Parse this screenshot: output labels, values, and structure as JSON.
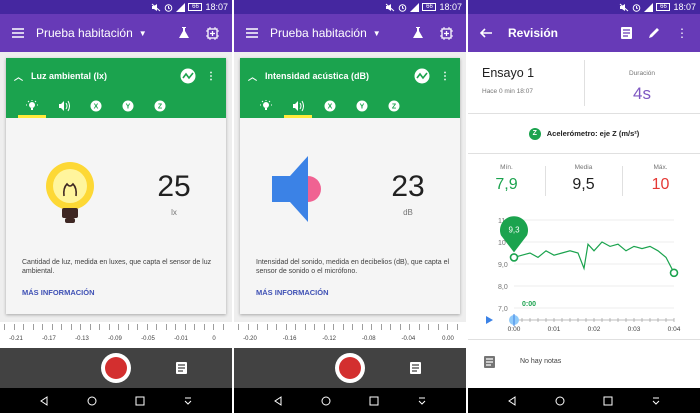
{
  "status": {
    "time": "18:07",
    "battery": "66"
  },
  "phone1": {
    "app_title": "Prueba habitación",
    "card_title": "Luz ambiental (lx)",
    "value": "25",
    "unit": "lx",
    "description": "Cantidad de luz, medida en luxes, que capta el sensor de luz ambiental.",
    "more_info": "MÁS INFORMACIÓN",
    "ruler_ticks": [
      "-0.21",
      "-0.17",
      "-0.13",
      "-0.09",
      "-0.05",
      "-0.01",
      "0"
    ]
  },
  "phone2": {
    "app_title": "Prueba habitación",
    "card_title": "Intensidad acústica (dB)",
    "value": "23",
    "unit": "dB",
    "description": "Intensidad del sonido, medida en decibelios (dB), que capta el sensor de sonido o el micrófono.",
    "more_info": "MÁS INFORMACIÓN",
    "ruler_ticks": [
      "-0.20",
      "-0.16",
      "-0.12",
      "-0.08",
      "-0.04",
      "0.00"
    ]
  },
  "phone3": {
    "app_title": "Revisión",
    "trial_name": "Ensayo 1",
    "trial_time": "Hace 0 min 18:07",
    "duration_label": "Duración",
    "duration_value": "4s",
    "sensor_label": "Acelerómetro: eje Z (m/s²)",
    "sensor_icon_letter": "Z",
    "stats": {
      "min_label": "Mín.",
      "min_value": "7,9",
      "avg_label": "Media",
      "avg_value": "9,5",
      "max_label": "Máx.",
      "max_value": "10"
    },
    "graph": {
      "y_ticks": [
        "11",
        "10",
        "9,0",
        "8,0",
        "7,0"
      ],
      "x_ticks": [
        "0:00",
        "0:01",
        "0:02",
        "0:03",
        "0:04"
      ],
      "pin_value": "9,3",
      "cursor_time": "0:00"
    },
    "notes_text": "No hay notas"
  },
  "colors": {
    "statusbar": "#4527a0",
    "appbar": "#673ab7",
    "sensor_green": "#1ba34e",
    "tab_highlight": "#ffeb3b",
    "min_color": "#1ba34e",
    "max_color": "#e53935",
    "duration_color": "#7e57c2"
  },
  "chart_data": {
    "type": "line",
    "title": "",
    "xlabel": "",
    "ylabel": "",
    "xlim": [
      0,
      4
    ],
    "ylim": [
      7,
      11
    ],
    "series": [
      {
        "x": [
          0.0,
          0.2,
          0.4,
          0.6,
          0.8,
          1.0,
          1.2,
          1.4,
          1.6,
          1.75,
          1.85,
          2.0,
          2.2,
          2.4,
          2.6,
          2.8,
          3.0,
          3.2,
          3.4,
          3.6,
          3.8,
          4.0
        ],
        "values": [
          9.3,
          9.4,
          9.5,
          9.3,
          9.6,
          9.4,
          9.5,
          9.6,
          9.5,
          8.8,
          9.9,
          9.6,
          10.0,
          9.8,
          9.9,
          9.6,
          9.8,
          9.7,
          9.8,
          9.6,
          9.3,
          8.6
        ]
      }
    ]
  }
}
